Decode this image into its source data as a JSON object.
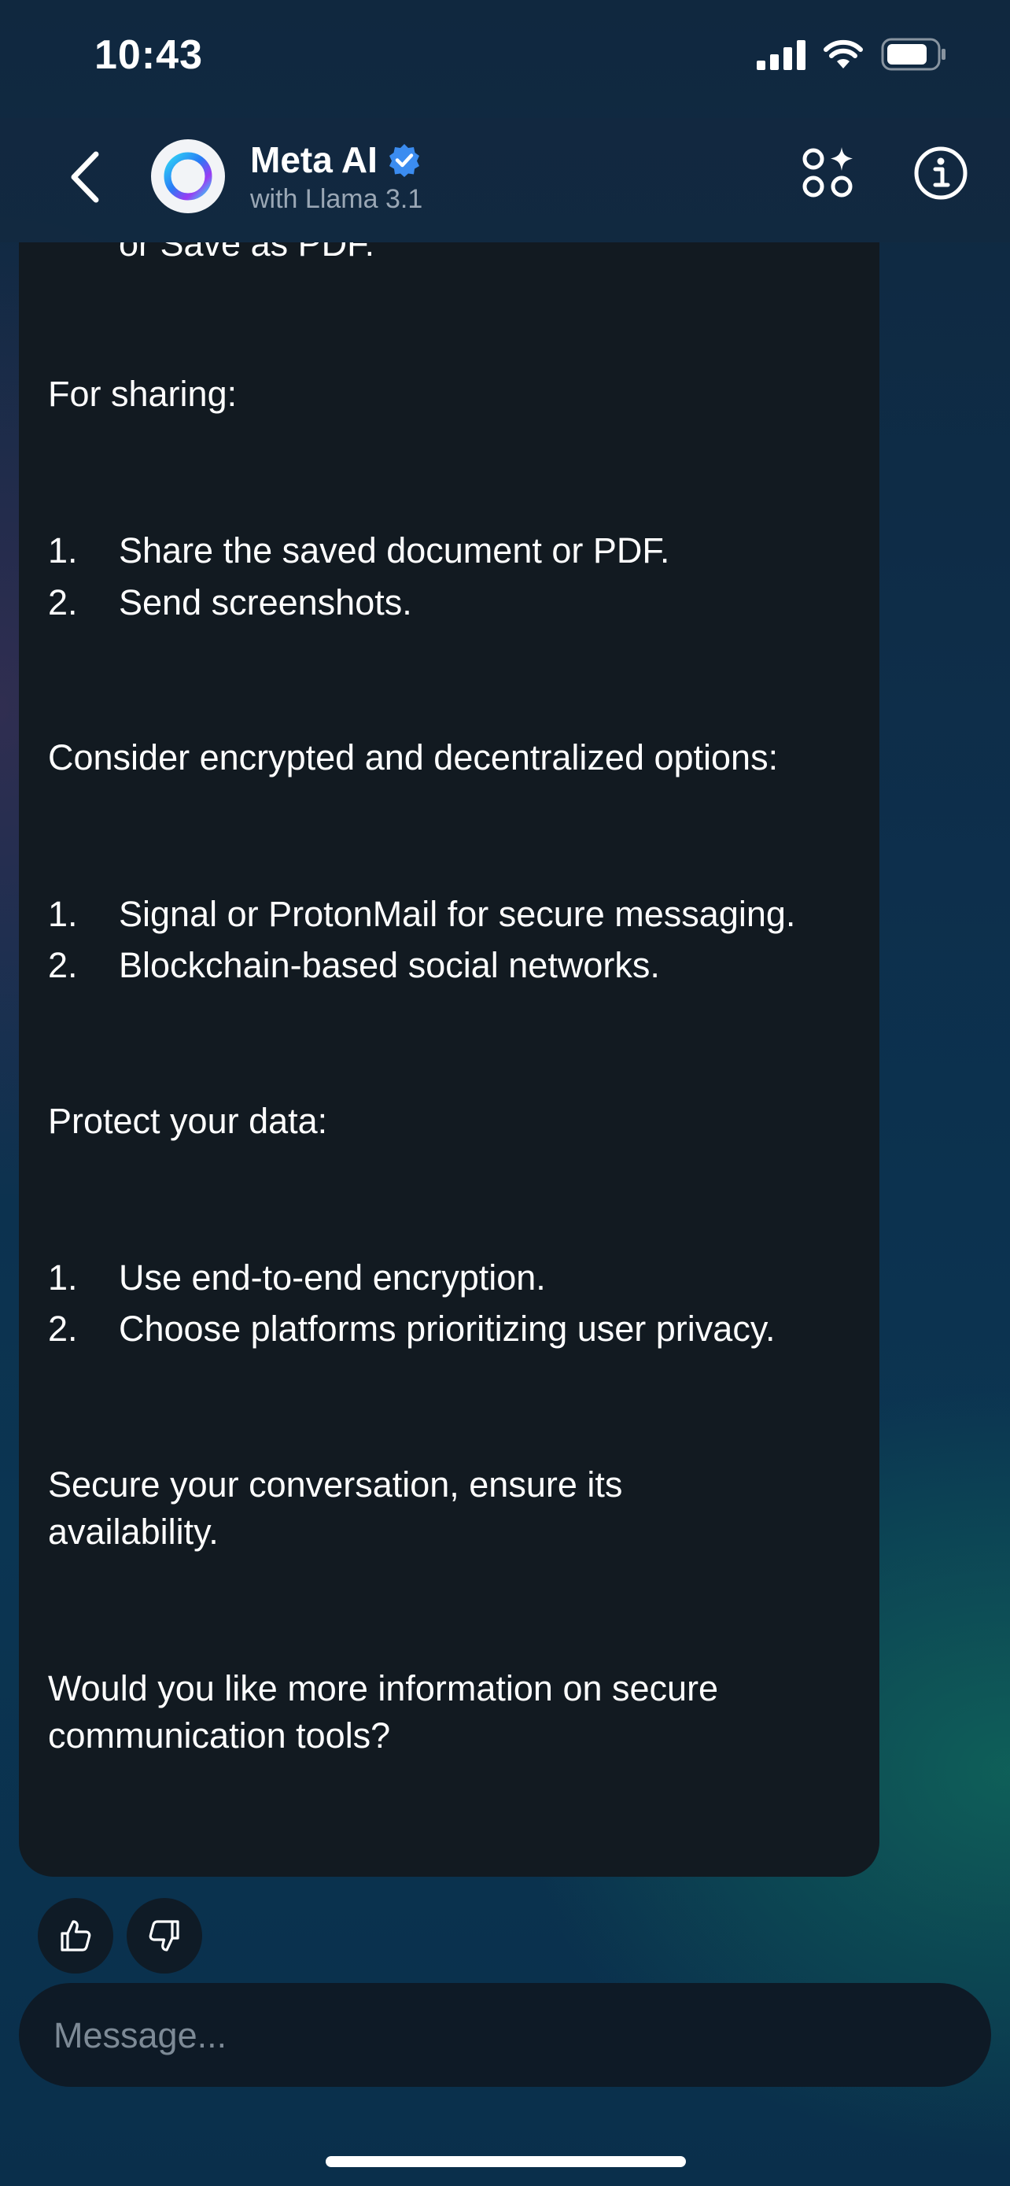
{
  "status_bar": {
    "time": "10:43"
  },
  "header": {
    "title": "Meta AI",
    "subtitle": "with Llama 3.1",
    "icons": [
      "back-chevron-icon",
      "meta-ai-ring-icon",
      "verified-badge-icon",
      "imagine-apps-icon",
      "info-icon"
    ],
    "accent_color": "#3b8cf0"
  },
  "message": {
    "cut_off_line": "or Save as PDF.",
    "sharing_heading": "For sharing:",
    "sharing_items": [
      {
        "num": "1.",
        "text": "Share the saved document or PDF."
      },
      {
        "num": "2.",
        "text": "Send screenshots."
      }
    ],
    "options_heading": "Consider encrypted and decentralized options:",
    "options_items": [
      {
        "num": "1.",
        "text": "Signal or ProtonMail for secure messaging."
      },
      {
        "num": "2.",
        "text": "Blockchain-based social networks."
      }
    ],
    "protect_heading": "Protect your data:",
    "protect_items": [
      {
        "num": "1.",
        "text": "Use end-to-end encryption."
      },
      {
        "num": "2.",
        "text": "Choose platforms prioritizing user privacy."
      }
    ],
    "secure_paragraph": [
      "Secure your conversation, ensure its",
      "availability."
    ],
    "question_paragraph": [
      "Would you like more information on secure",
      "communication tools?"
    ]
  },
  "feedback": {
    "icons": [
      "thumbs-up-icon",
      "thumbs-down-icon"
    ]
  },
  "composer": {
    "placeholder": "Message..."
  },
  "colors": {
    "bubble": "#121a21",
    "muted_text": "#9aa7b5"
  }
}
